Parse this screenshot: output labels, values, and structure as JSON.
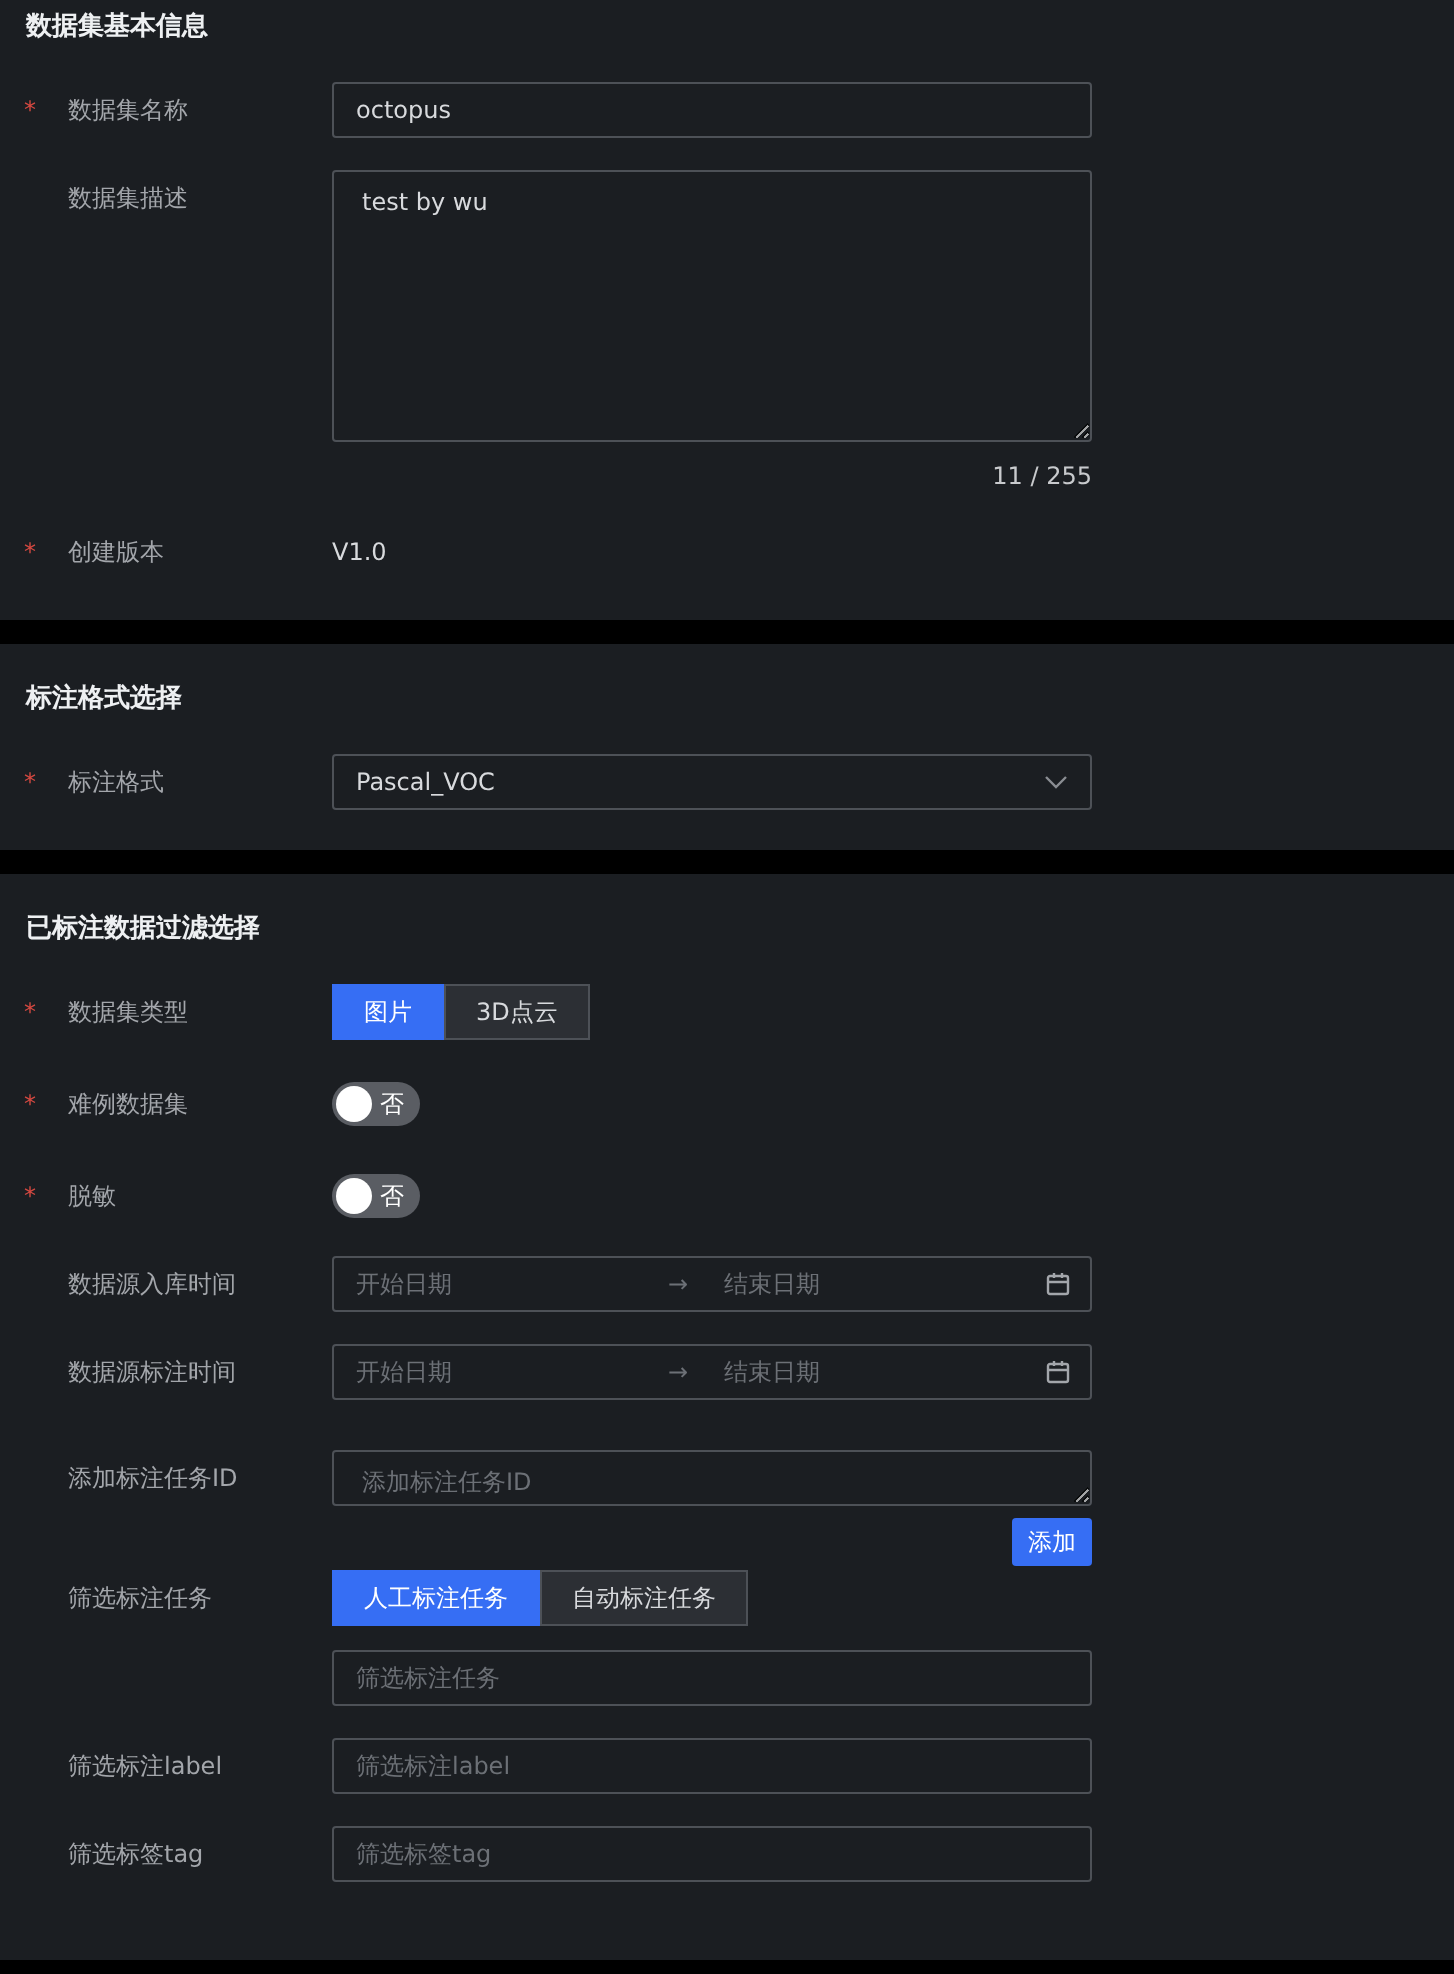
{
  "sections": [
    {
      "title": "数据集基本信息",
      "fields": [
        {
          "kind": "input",
          "required_mark": "*",
          "label": "数据集名称",
          "value": "octopus"
        },
        {
          "kind": "textarea",
          "label": "数据集描述",
          "value": "test by wu",
          "counter": "11 / 255"
        },
        {
          "kind": "text",
          "required_mark": "*",
          "label": "创建版本",
          "value": "V1.0"
        }
      ]
    },
    {
      "title": "标注格式选择",
      "fields": [
        {
          "kind": "select",
          "required_mark": "*",
          "label": "标注格式",
          "value": "Pascal_VOC"
        }
      ]
    },
    {
      "title": "已标注数据过滤选择",
      "fields": [
        {
          "kind": "segmented",
          "required_mark": "*",
          "label": "数据集类型",
          "options": [
            {
              "label": "图片",
              "selected": true
            },
            {
              "label": "3D点云",
              "selected": false
            }
          ]
        },
        {
          "kind": "switch",
          "required_mark": "*",
          "label": "难例数据集",
          "on": false,
          "text": "否"
        },
        {
          "kind": "switch",
          "required_mark": "*",
          "label": "脱敏",
          "on": false,
          "text": "否"
        },
        {
          "kind": "daterange",
          "label": "数据源入库时间",
          "start_placeholder": "开始日期",
          "separator": "→",
          "end_placeholder": "结束日期"
        },
        {
          "kind": "daterange",
          "label": "数据源标注时间",
          "start_placeholder": "开始日期",
          "separator": "→",
          "end_placeholder": "结束日期"
        },
        {
          "kind": "textarea",
          "label": "添加标注任务ID",
          "placeholder": "添加标注任务ID",
          "button": "添加"
        },
        {
          "kind": "segmented",
          "label": "筛选标注任务",
          "options": [
            {
              "label": "人工标注任务",
              "selected": true
            },
            {
              "label": "自动标注任务",
              "selected": false
            }
          ]
        },
        {
          "kind": "input",
          "placeholder": "筛选标注任务"
        },
        {
          "kind": "input",
          "label": "筛选标注label",
          "placeholder": "筛选标注label"
        },
        {
          "kind": "input",
          "label": "筛选标签tag",
          "placeholder": "筛选标签tag"
        }
      ]
    }
  ]
}
